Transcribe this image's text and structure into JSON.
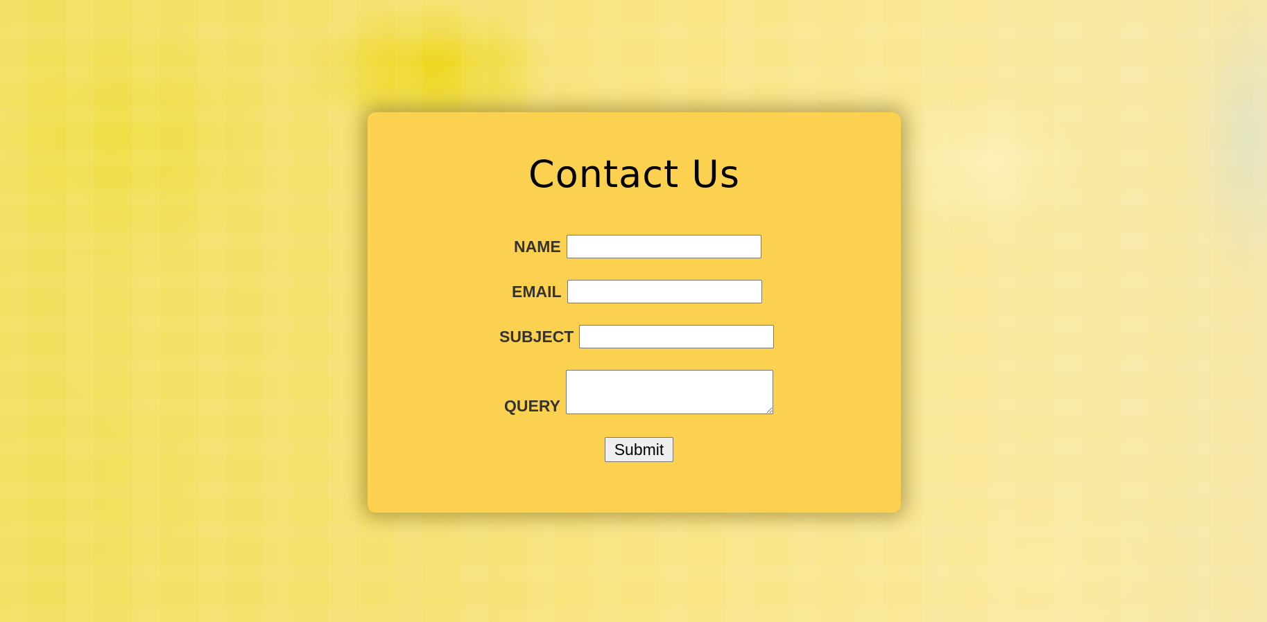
{
  "form": {
    "title": "Contact Us",
    "fields": {
      "name": {
        "label": "NAME",
        "value": "",
        "placeholder": ""
      },
      "email": {
        "label": "EMAIL",
        "value": "",
        "placeholder": ""
      },
      "subject": {
        "label": "SUBJECT",
        "value": "",
        "placeholder": ""
      },
      "query": {
        "label": "QUERY",
        "value": "",
        "placeholder": ""
      }
    },
    "submit_label": "Submit"
  },
  "colors": {
    "card_background": "#fdd150",
    "page_background": "#f8e27a",
    "label_text": "#333333"
  }
}
